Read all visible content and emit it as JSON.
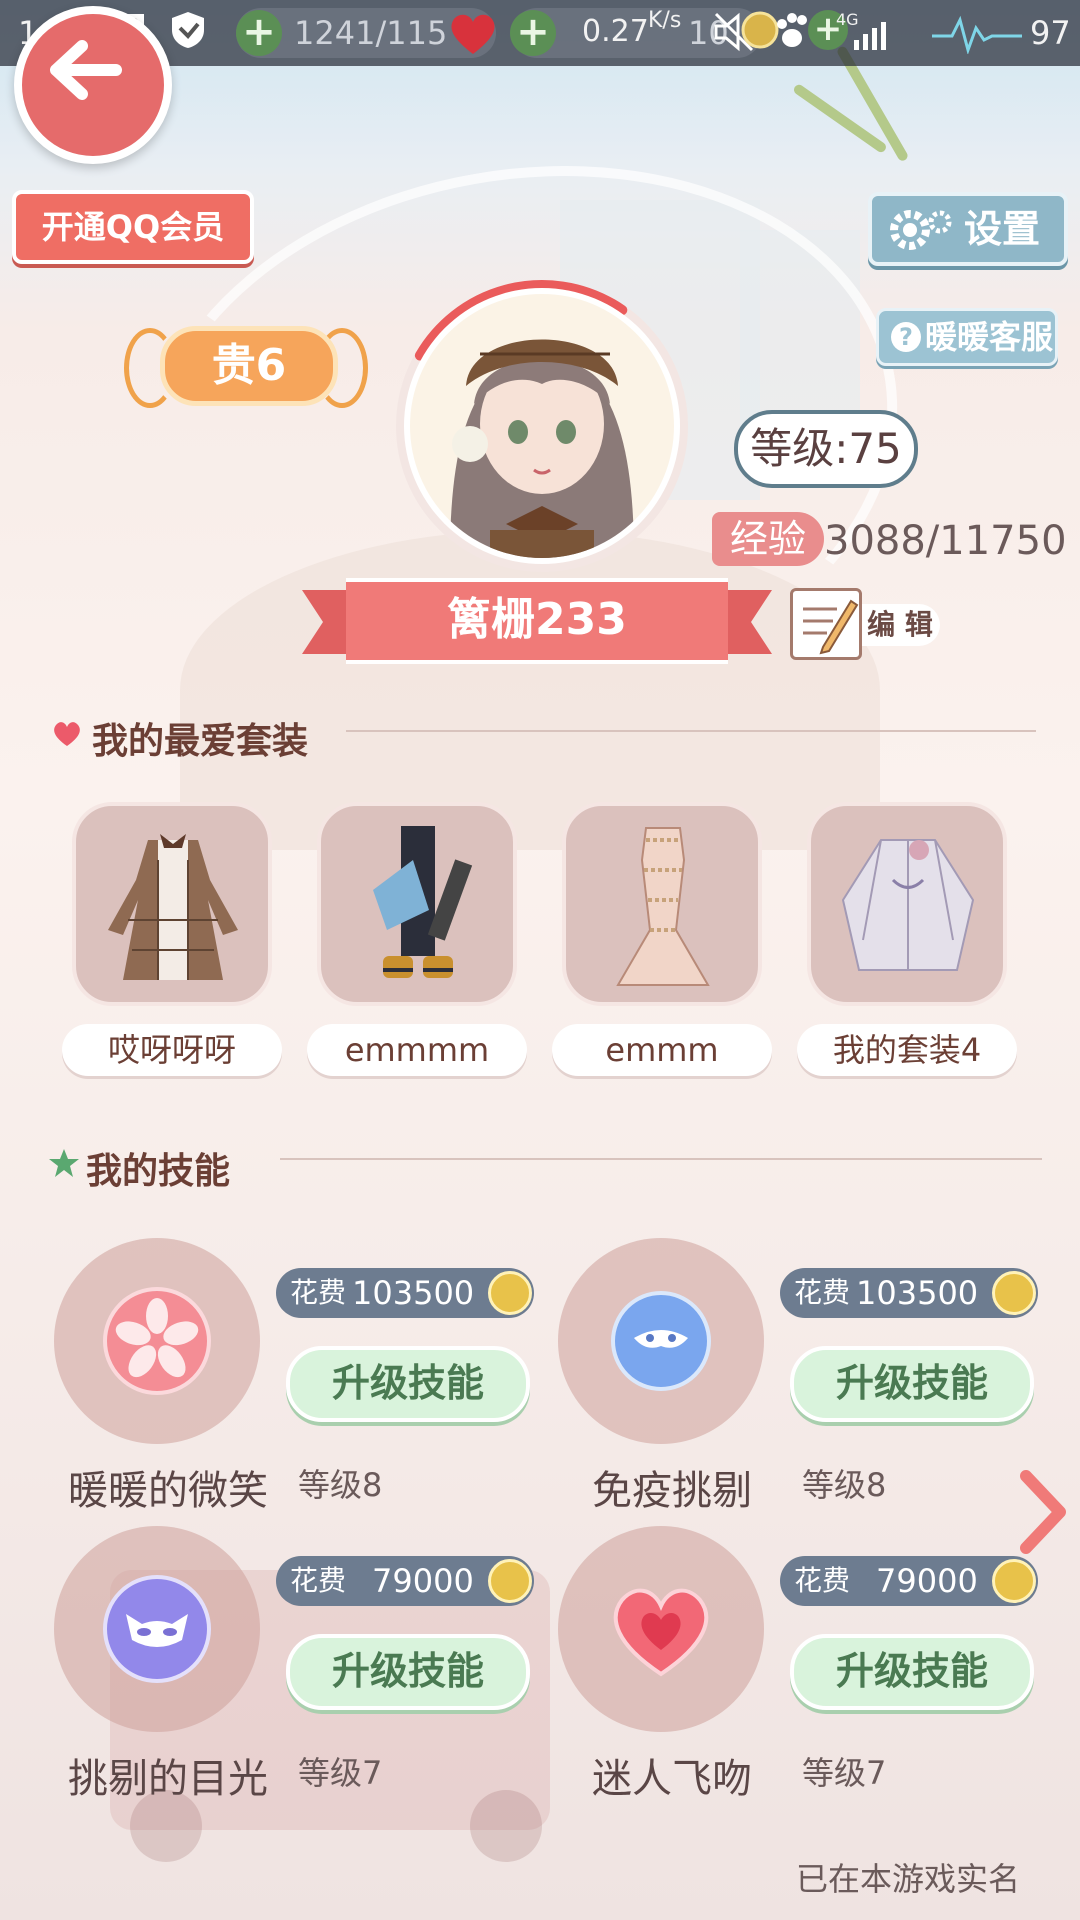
{
  "status_bar": {
    "time": "14:47",
    "currency1": "1241/115",
    "net_speed": "0.27",
    "net_unit": "K/s",
    "currency2_partial": "10",
    "signal": "4G",
    "battery": "97"
  },
  "header": {
    "qq_vip_label": "开通QQ会员",
    "settings_label": "设置",
    "support_label": "暖暖客服"
  },
  "profile": {
    "vip_level": "贵6",
    "level": "等级:75",
    "exp_label": "经验",
    "exp_value": "3088/11750",
    "exp_progress": 0.263,
    "name": "篱栅233",
    "edit_label": "编 辑"
  },
  "favorites": {
    "title": "我的最爱套装",
    "items": [
      {
        "label": "哎呀呀呀",
        "icon": "plaid-dress-icon"
      },
      {
        "label": "emmmm",
        "icon": "black-outfit-icon"
      },
      {
        "label": "emmm",
        "icon": "lace-gown-icon"
      },
      {
        "label": "我的套装4",
        "icon": "white-robe-icon"
      }
    ]
  },
  "skills": {
    "title": "我的技能",
    "cost_label": "花费",
    "upgrade_label": "升级技能",
    "items": [
      {
        "name": "暖暖的微笑",
        "cost": "103500",
        "level": "等级8",
        "icon": "sakura-icon",
        "color": "#f07e86"
      },
      {
        "name": "免疫挑剔",
        "cost": "103500",
        "level": "等级8",
        "icon": "winged-mask-icon",
        "color": "#6f9fe8"
      },
      {
        "name": "挑剔的目光",
        "cost": "79000",
        "level": "等级7",
        "icon": "cat-mask-icon",
        "color": "#8f86e6"
      },
      {
        "name": "迷人飞吻",
        "cost": "79000",
        "level": "等级7",
        "icon": "heart-icon",
        "color": "#f06a78"
      }
    ]
  },
  "footer": {
    "realname_notice": "已在本游戏实名"
  },
  "colors": {
    "accent_red": "#ef6e64",
    "accent_blue": "#8fb7c8",
    "upgrade_green": "#d9f3dc"
  }
}
